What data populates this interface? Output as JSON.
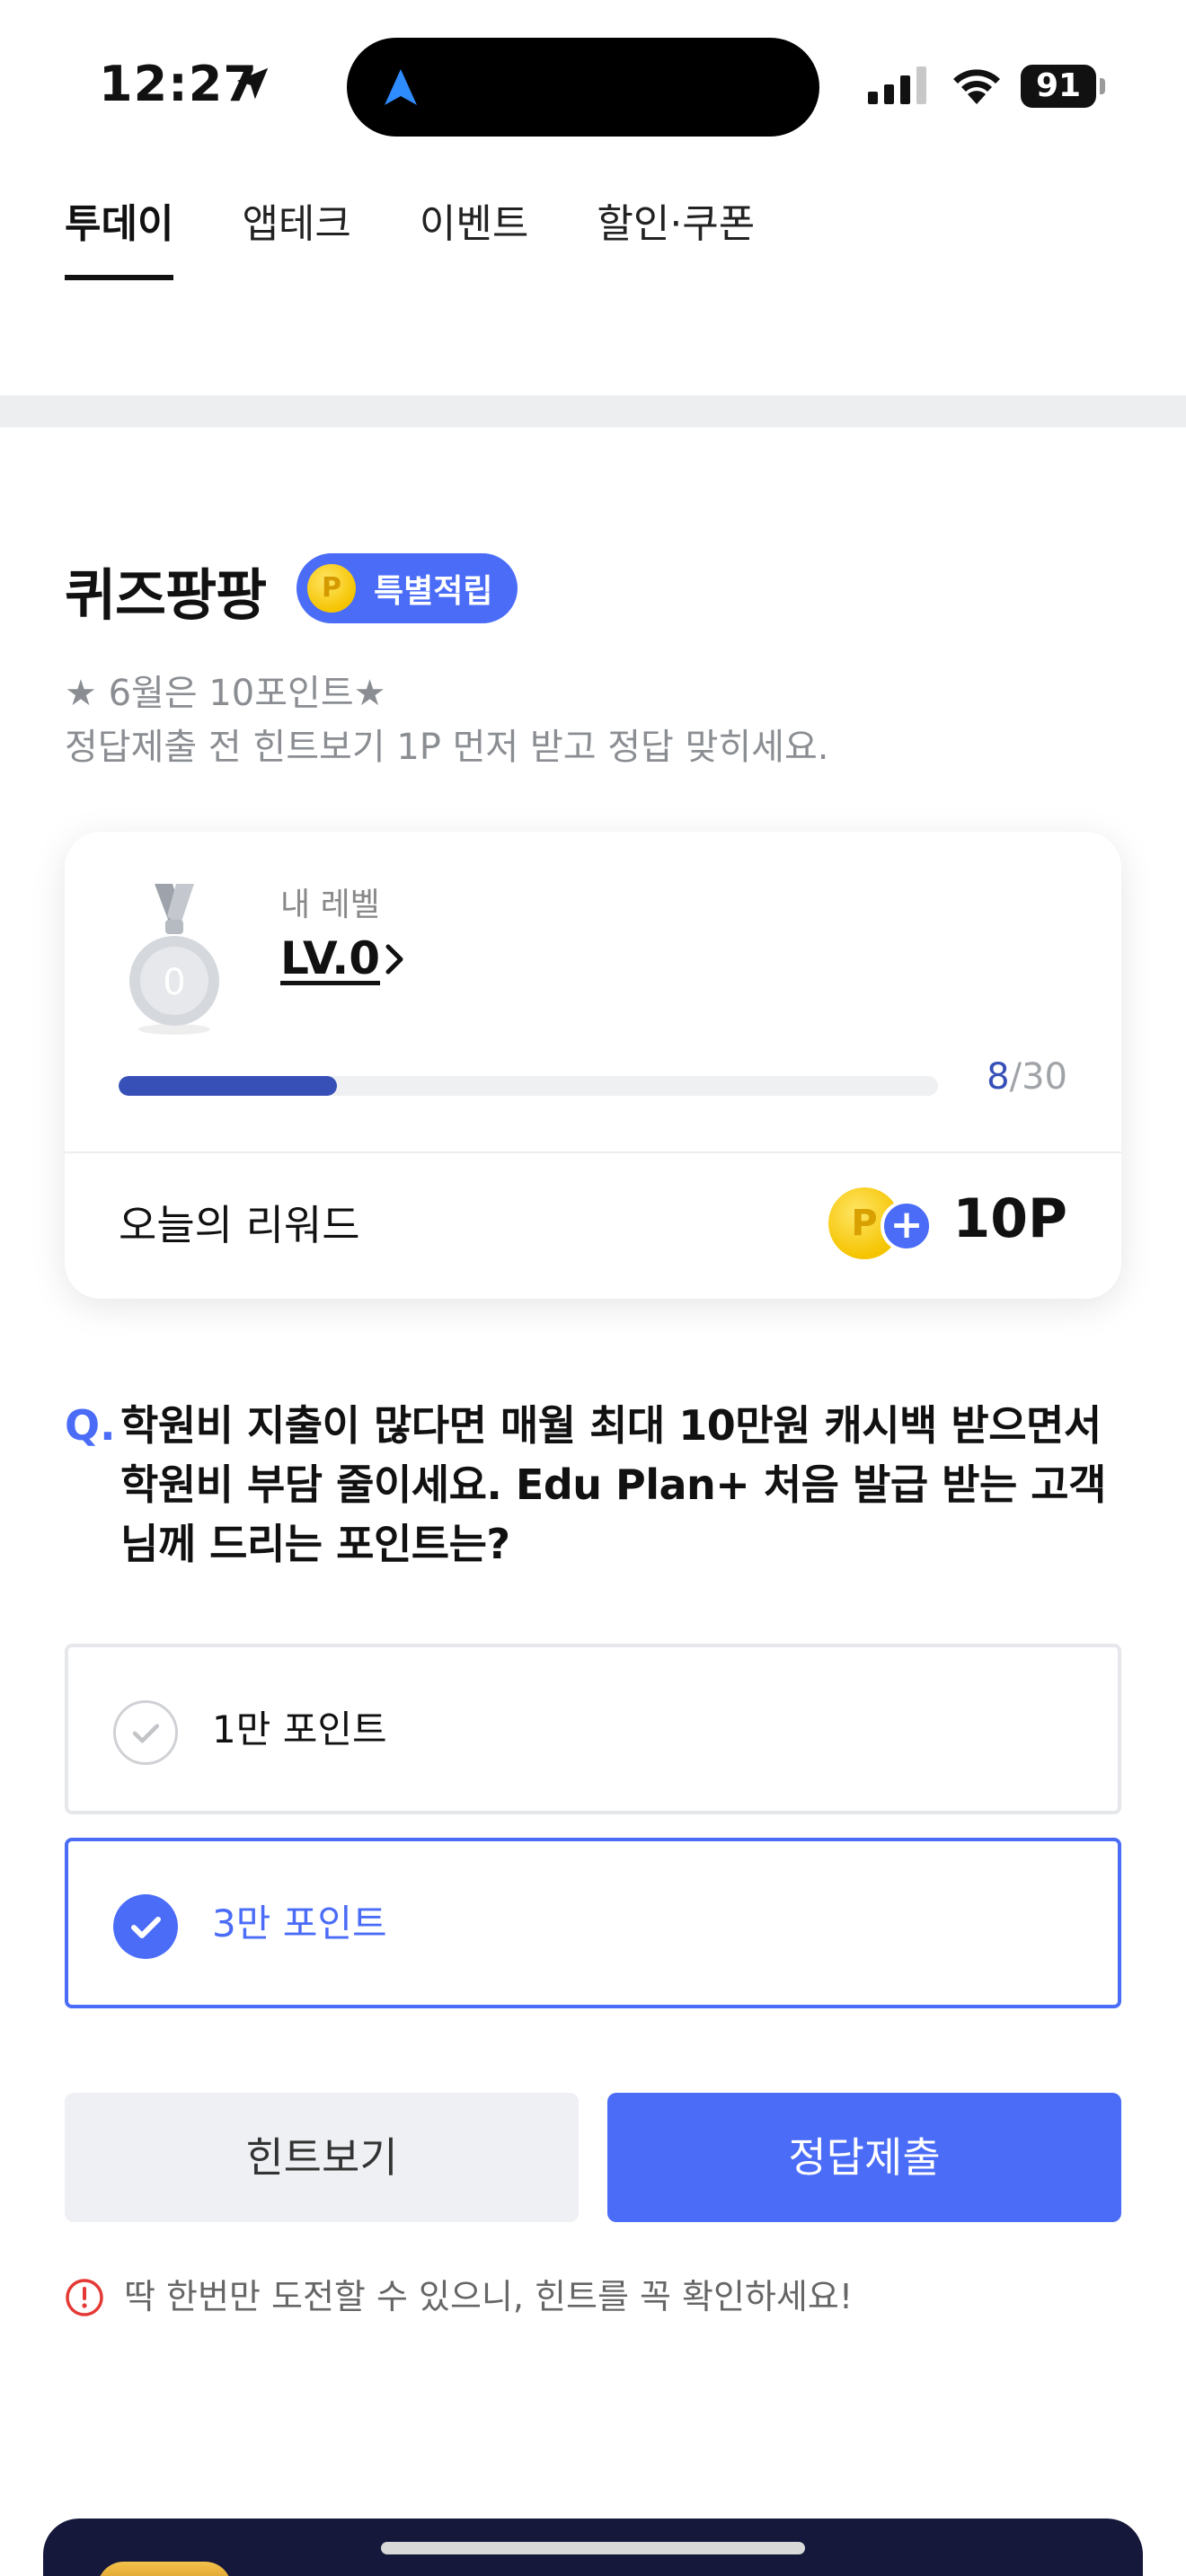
{
  "status_bar": {
    "time": "12:27",
    "battery": "91"
  },
  "tabs": [
    {
      "label": "투데이",
      "active": true
    },
    {
      "label": "앱테크",
      "active": false
    },
    {
      "label": "이벤트",
      "active": false
    },
    {
      "label": "할인·쿠폰",
      "active": false
    }
  ],
  "quiz": {
    "title": "퀴즈팡팡",
    "badge": "특별적립",
    "badge_coin": "P",
    "subtitle_line1": "★ 6월은 10포인트★",
    "subtitle_line2": "정답제출 전 힌트보기 1P 먼저 받고 정답 맞히세요."
  },
  "level_card": {
    "medal_number": "0",
    "label": "내 레벨",
    "level": "LV.0",
    "progress_current": "8",
    "progress_total": "/30",
    "progress_fraction": 0.2667,
    "reward_label": "오늘의 리워드",
    "reward_coin": "P",
    "reward_plus": "+",
    "reward_points": "10P"
  },
  "question": {
    "mark": "Q.",
    "text": "학원비 지출이 많다면 매월 최대 10만원 캐시백 받으면서 학원비 부담 줄이세요. Edu Plan+ 처음 발급 받는 고객님께 드리는 포인트는?"
  },
  "options": [
    {
      "label": "1만 포인트",
      "selected": false
    },
    {
      "label": "3만 포인트",
      "selected": true
    }
  ],
  "buttons": {
    "hint": "힌트보기",
    "submit": "정답제출"
  },
  "warning": "딱 한번만 도전할 수 있으니, 힌트를 꼭 확인하세요!",
  "colors": {
    "accent": "#4a6cf7",
    "progress": "#3750b8",
    "coin": "#f5c400",
    "dark_card": "#15183a"
  }
}
